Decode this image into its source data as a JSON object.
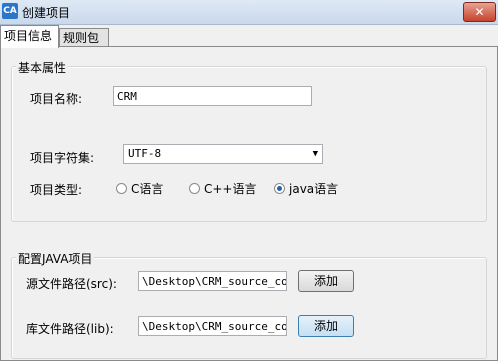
{
  "window": {
    "icon_text": "CA",
    "title": "创建项目",
    "close": "✕"
  },
  "tabs": [
    {
      "label": "项目信息"
    },
    {
      "label": "规则包"
    }
  ],
  "basic": {
    "group_title": "基本属性",
    "name_label": "项目名称:",
    "name_value": "CRM",
    "charset_label": "项目字符集:",
    "charset_value": "UTF-8",
    "type_label": "项目类型:",
    "types": [
      "C语言",
      "C++语言",
      "java语言"
    ],
    "selected_type": "java语言"
  },
  "java": {
    "group_title": "配置JAVA项目",
    "src_label": "源文件路径(src):",
    "src_value": "\\Desktop\\CRM_source_code",
    "src_button": "添加",
    "lib_label": "库文件路径(lib):",
    "lib_value": "\\Desktop\\CRM_source_code",
    "lib_button": "添加"
  }
}
